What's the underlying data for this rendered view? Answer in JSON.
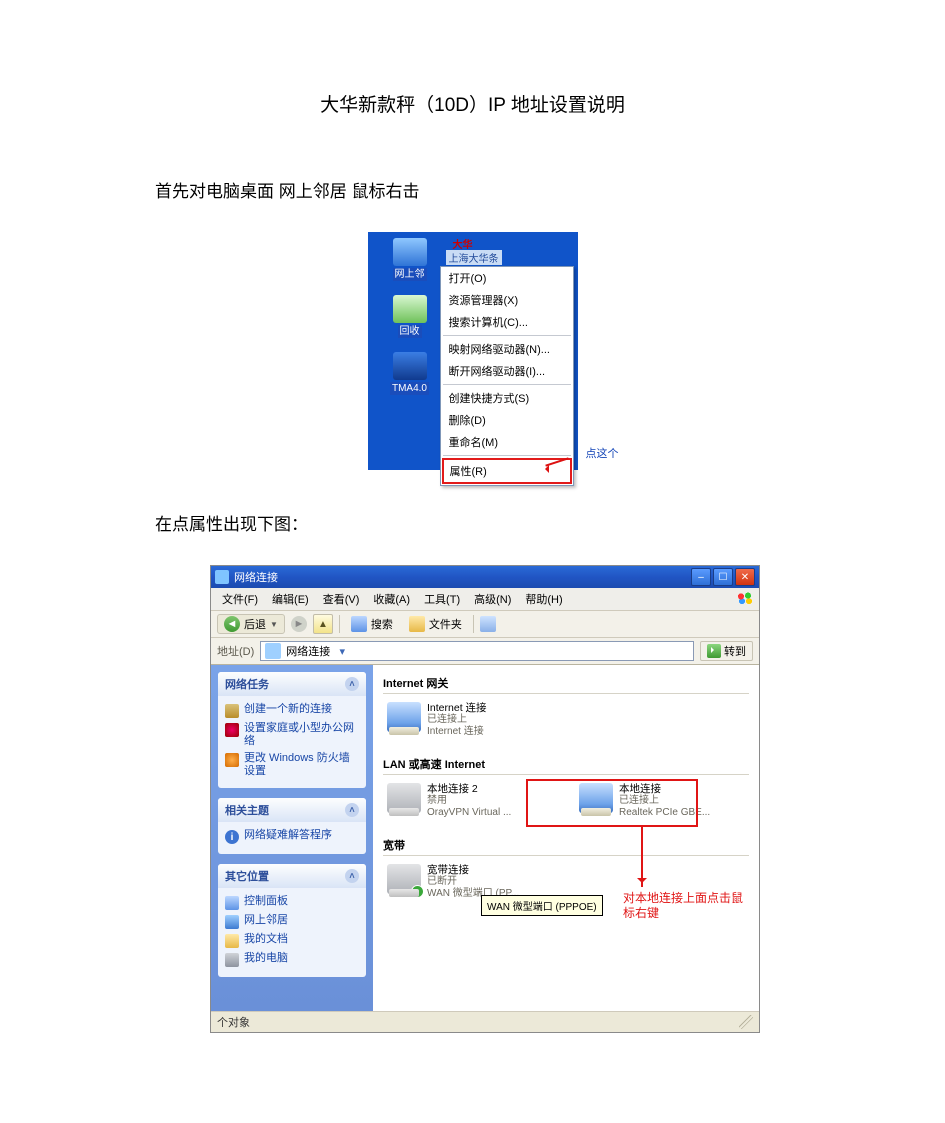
{
  "doc": {
    "title": "大华新款秤（10D）IP 地址设置说明",
    "step1": "首先对电脑桌面 网上邻居 鼠标右击",
    "step2": "在点属性出现下图："
  },
  "shot1": {
    "top_red": "大华",
    "caption": "上海大华条",
    "icons": {
      "network": "网上邻",
      "recycle": "回收",
      "app": "TMA4.0"
    },
    "menu": {
      "open": "打开(O)",
      "explorer": "资源管理器(X)",
      "search_pc": "搜索计算机(C)...",
      "map_drive": "映射网络驱动器(N)...",
      "disconnect": "断开网络驱动器(I)...",
      "shortcut": "创建快捷方式(S)",
      "delete": "删除(D)",
      "rename": "重命名(M)",
      "properties": "属性(R)"
    },
    "callout": "点这个"
  },
  "shot2": {
    "title": "网络连接",
    "menu": {
      "file": "文件(F)",
      "edit": "编辑(E)",
      "view": "查看(V)",
      "fav": "收藏(A)",
      "tools": "工具(T)",
      "adv": "高级(N)",
      "help": "帮助(H)"
    },
    "toolbar": {
      "back": "后退",
      "search": "搜索",
      "folders": "文件夹"
    },
    "addr": {
      "label": "地址(D)",
      "value": "网络连接",
      "go": "转到"
    },
    "sidebar": {
      "tasks_head": "网络任务",
      "t1": "创建一个新的连接",
      "t2": "设置家庭或小型办公网络",
      "t3": "更改 Windows 防火墙设置",
      "related_head": "相关主题",
      "r1": "网络疑难解答程序",
      "other_head": "其它位置",
      "o1": "控制面板",
      "o2": "网上邻居",
      "o3": "我的文档",
      "o4": "我的电脑"
    },
    "content": {
      "sec1": "Internet 网关",
      "gw_name": "Internet 连接",
      "gw_status": "已连接上",
      "gw_dev": "Internet 连接",
      "sec2": "LAN 或高速 Internet",
      "lan2_name": "本地连接 2",
      "lan2_status": "禁用",
      "lan2_dev": "OrayVPN Virtual ...",
      "lan_name": "本地连接",
      "lan_status": "已连接上",
      "lan_dev": "Realtek PCIe GBE...",
      "sec3": "宽带",
      "bb_name": "宽带连接",
      "bb_status": "已断开",
      "bb_dev": "WAN 微型端口 (PP...",
      "tooltip": "WAN 微型端口 (PPPOE)",
      "annotation": "对本地连接上面点击鼠标右键"
    },
    "status": "个对象"
  }
}
